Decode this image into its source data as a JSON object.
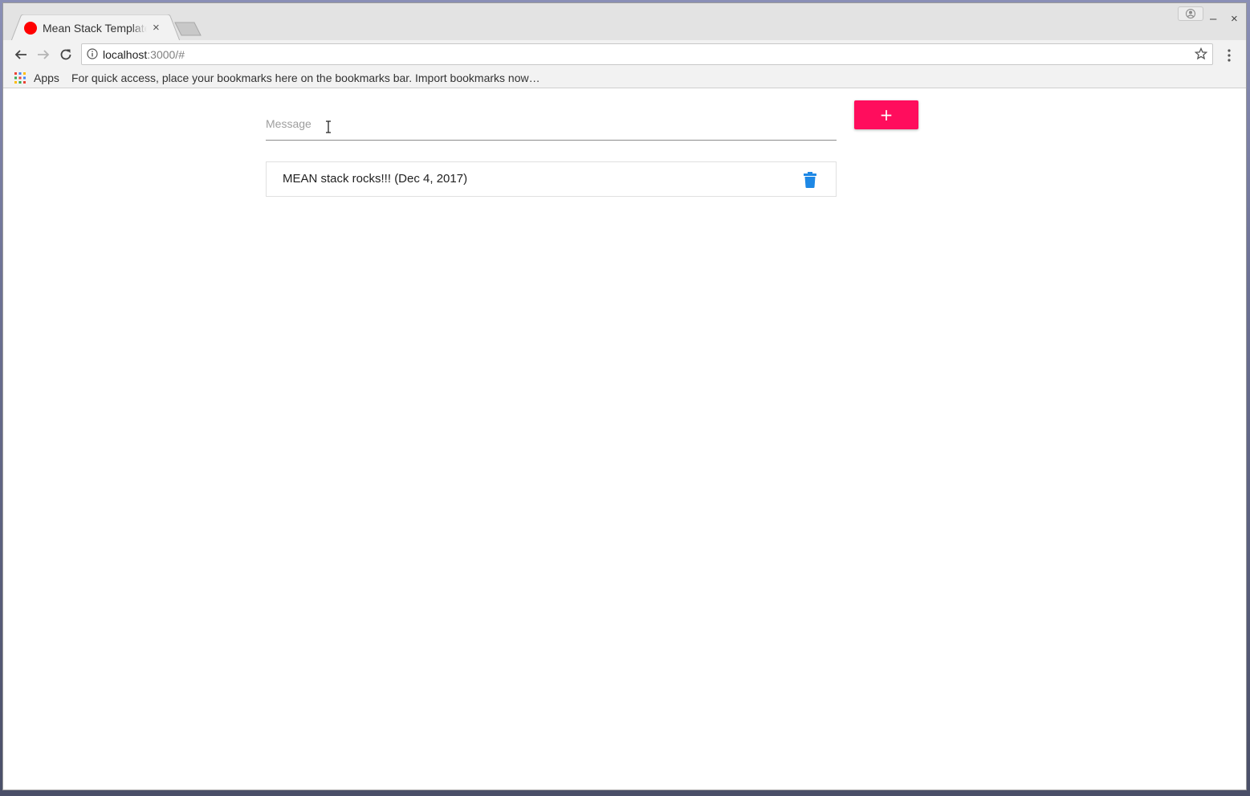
{
  "browser": {
    "tab_title": "Mean Stack Template",
    "tab_favicon_color": "#ff0000",
    "close_tab_glyph": "×",
    "minimize_glyph": "–",
    "close_window_glyph": "×",
    "url_host": "localhost",
    "url_path": ":3000/#",
    "icons": [
      "back-icon",
      "forward-icon",
      "reload-icon",
      "info-icon",
      "star-icon",
      "menu-icon",
      "apps-icon",
      "profile-icon"
    ]
  },
  "bookmarks": {
    "apps_label": "Apps",
    "hint": "For quick access, place your bookmarks here on the bookmarks bar. Import bookmarks now…"
  },
  "form": {
    "placeholder": "Message",
    "value": "",
    "add_label": "+",
    "add_color": "#ff0d5d"
  },
  "messages": [
    {
      "text": "MEAN stack rocks!!! (Dec 4, 2017)",
      "icon": "trash-icon",
      "icon_color": "#1e88e5"
    }
  ]
}
